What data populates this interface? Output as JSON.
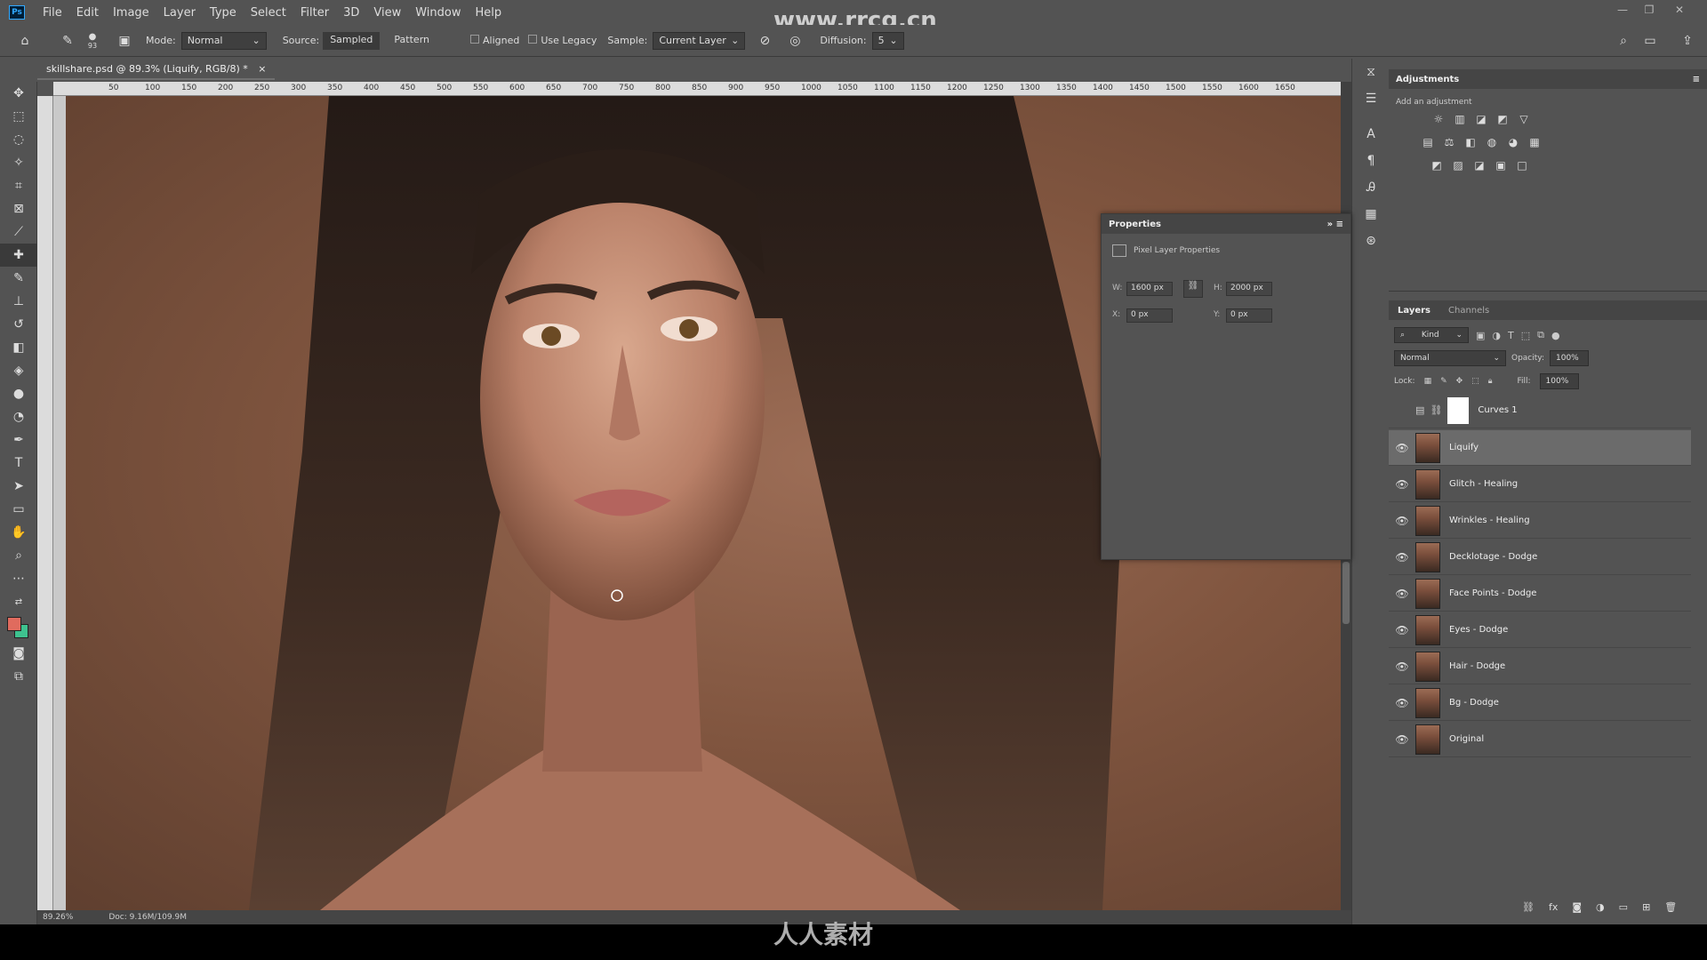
{
  "menubar": {
    "items": [
      "File",
      "Edit",
      "Image",
      "Layer",
      "Type",
      "Select",
      "Filter",
      "3D",
      "View",
      "Window",
      "Help"
    ]
  },
  "watermark": {
    "top": "www.rrcg.cn",
    "bottom": "人人素材"
  },
  "options": {
    "brush_size": "93",
    "mode_label": "Mode:",
    "mode_value": "Normal",
    "source_label": "Source:",
    "source_sampled": "Sampled",
    "source_pattern": "Pattern",
    "aligned": "Aligned",
    "use_legacy": "Use Legacy",
    "sample_label": "Sample:",
    "sample_value": "Current Layer",
    "diffusion_label": "Diffusion:",
    "diffusion_value": "5"
  },
  "document": {
    "tab_title": "skillshare.psd @ 89.3% (Liquify, RGB/8) *",
    "close": "×",
    "zoom": "89.26%",
    "doc_info": "Doc: 9.16M/109.9M"
  },
  "ruler": {
    "ticks": [
      "50",
      "100",
      "150",
      "200",
      "250",
      "300",
      "350",
      "400",
      "450",
      "500",
      "550",
      "600",
      "650",
      "700",
      "750",
      "800",
      "850",
      "900",
      "950",
      "1000",
      "1050",
      "1100",
      "1150",
      "1200",
      "1250",
      "1300",
      "1350",
      "1400",
      "1450",
      "1500",
      "1550",
      "1600",
      "1650"
    ]
  },
  "properties": {
    "title": "Properties",
    "subtitle": "Pixel Layer Properties",
    "w_label": "W:",
    "w_value": "1600 px",
    "h_label": "H:",
    "h_value": "2000 px",
    "x_label": "X:",
    "x_value": "0 px",
    "y_label": "Y:",
    "y_value": "0 px"
  },
  "adjustments": {
    "title": "Adjustments",
    "subtitle": "Add an adjustment"
  },
  "layers": {
    "tabs": [
      "Layers",
      "Channels"
    ],
    "filter_kind": "Kind",
    "blend": "Normal",
    "opacity_label": "Opacity:",
    "opacity_value": "100%",
    "lock_label": "Lock:",
    "fill_label": "Fill:",
    "fill_value": "100%",
    "curves": "Curves 1",
    "items": [
      {
        "name": "Liquify",
        "selected": true
      },
      {
        "name": "Glitch - Healing"
      },
      {
        "name": "Wrinkles - Healing"
      },
      {
        "name": "Decklotage - Dodge"
      },
      {
        "name": "Face Points - Dodge"
      },
      {
        "name": "Eyes - Dodge"
      },
      {
        "name": "Hair - Dodge"
      },
      {
        "name": "Bg - Dodge"
      },
      {
        "name": "Original"
      }
    ]
  },
  "colors": {
    "foreground": "#e06b5e",
    "background": "#3ec28f",
    "panel_bg": "#535353",
    "canvas_bg": "#80553f"
  },
  "icons": {
    "home": "home-icon",
    "healing": "healing-brush-icon",
    "search": "search-icon"
  }
}
